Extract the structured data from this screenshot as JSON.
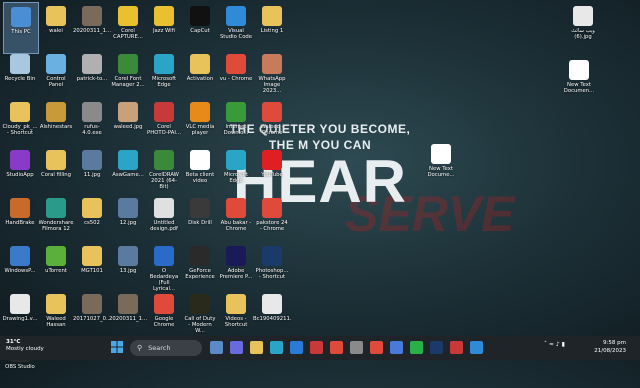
{
  "wallpaper": {
    "line1": "THE QUIETER YOU BECOME,",
    "line2": "THE M   YOU CAN",
    "line3": "HEAR",
    "overlay": "SERVE"
  },
  "desktop_icons": [
    {
      "label": "This PC",
      "icon": "this-pc-icon",
      "color": "#4a8fd6",
      "selected": true
    },
    {
      "label": "walei",
      "icon": "folder-icon",
      "color": "#e8c25a"
    },
    {
      "label": "20200311_1...",
      "icon": "image-file-icon",
      "color": "#7a6a5a"
    },
    {
      "label": "Corel CAPTURE...",
      "icon": "corel-capture-icon",
      "color": "#e8c030"
    },
    {
      "label": "Jazz Wifi",
      "icon": "jazz-wifi-icon",
      "color": "#e8c030"
    },
    {
      "label": "CapCut",
      "icon": "capcut-icon",
      "color": "#111111"
    },
    {
      "label": "Visual Studio Code",
      "icon": "vscode-icon",
      "color": "#2f8ad8"
    },
    {
      "label": "Listing 1",
      "icon": "folder-icon",
      "color": "#e8c25a"
    },
    {
      "label": "Recycle Bin",
      "icon": "recycle-bin-icon",
      "color": "#a8c8e0"
    },
    {
      "label": "Control Panel",
      "icon": "control-panel-icon",
      "color": "#6ab0e0"
    },
    {
      "label": "patrick-to...",
      "icon": "image-file-icon",
      "color": "#b0b0b0"
    },
    {
      "label": "Corel Font Manager 2...",
      "icon": "corel-font-icon",
      "color": "#3a8a3a"
    },
    {
      "label": "Microsoft Edge",
      "icon": "edge-icon",
      "color": "#2aa5c8"
    },
    {
      "label": "Activation",
      "icon": "folder-icon",
      "color": "#e8c25a"
    },
    {
      "label": "vu - Chrome",
      "icon": "chrome-icon",
      "color": "#e04a3a"
    },
    {
      "label": "WhatsApp Image 2023...",
      "icon": "image-file-icon",
      "color": "#c87a5a"
    },
    {
      "label": "Cloudy_pk_... - Shortcut",
      "icon": "folder-icon",
      "color": "#e8c25a"
    },
    {
      "label": "Alshinestars",
      "icon": "video-icon",
      "color": "#c89a3a"
    },
    {
      "label": "rufus-4.0.exe",
      "icon": "usb-icon",
      "color": "#8a8a8a"
    },
    {
      "label": "waleed.jpg",
      "icon": "image-file-icon",
      "color": "#c8a07a"
    },
    {
      "label": "Corel PHOTO-PAI...",
      "icon": "corel-photo-icon",
      "color": "#c83a3a"
    },
    {
      "label": "VLC media player",
      "icon": "vlc-icon",
      "color": "#e88a1a"
    },
    {
      "label": "Internet Downlo...",
      "icon": "idm-icon",
      "color": "#3a9a3a"
    },
    {
      "label": "Waleed - Chrome",
      "icon": "chrome-icon",
      "color": "#e04a3a"
    },
    {
      "label": "StudioApp",
      "icon": "studio-icon",
      "color": "#8a3ac8"
    },
    {
      "label": "Coral filling",
      "icon": "folder-icon",
      "color": "#e8c25a"
    },
    {
      "label": "11.jpg",
      "icon": "image-file-icon",
      "color": "#5a7aa0"
    },
    {
      "label": "AswGame...",
      "icon": "edge-icon",
      "color": "#2aa5c8"
    },
    {
      "label": "CorelDRAW 2021 (64-Bit)",
      "icon": "coreldraw-icon",
      "color": "#3a8a3a"
    },
    {
      "label": "Beta client video",
      "icon": "video-file-icon",
      "color": "#ffffff"
    },
    {
      "label": "Microsoft Edge",
      "icon": "edge-icon",
      "color": "#2aa5c8"
    },
    {
      "label": "YouTube",
      "icon": "youtube-icon",
      "color": "#e02020"
    },
    {
      "label": "HandBrake",
      "icon": "handbrake-icon",
      "color": "#c86a2a"
    },
    {
      "label": "Wondershare Filmora 12",
      "icon": "filmora-icon",
      "color": "#2a9a8a"
    },
    {
      "label": "cs502",
      "icon": "folder-icon",
      "color": "#e8c25a"
    },
    {
      "label": "12.jpg",
      "icon": "image-file-icon",
      "color": "#5a7aa0"
    },
    {
      "label": "Untitled design.pdf",
      "icon": "pdf-icon",
      "color": "#e0e0e0"
    },
    {
      "label": "Disk Drill",
      "icon": "disk-drill-icon",
      "color": "#3a3a3a"
    },
    {
      "label": "Abu bakar - Chrome",
      "icon": "chrome-icon",
      "color": "#e04a3a"
    },
    {
      "label": "pakstore 24 - Chrome",
      "icon": "chrome-icon",
      "color": "#e04a3a"
    },
    {
      "label": "WindowsP...",
      "icon": "windows-icon",
      "color": "#3a7ac8"
    },
    {
      "label": "uTorrent",
      "icon": "utorrent-icon",
      "color": "#5ab03a"
    },
    {
      "label": "MGT101",
      "icon": "folder-icon",
      "color": "#e8c25a"
    },
    {
      "label": "13.jpg",
      "icon": "image-file-icon",
      "color": "#5a7aa0"
    },
    {
      "label": "O Bedardeya (Full Lyrical...",
      "icon": "media-file-icon",
      "color": "#2a6ac8"
    },
    {
      "label": "GeForce Experience",
      "icon": "geforce-icon",
      "color": "#2a2a2a"
    },
    {
      "label": "Adobe Premiere P...",
      "icon": "premiere-icon",
      "color": "#1a1a5a"
    },
    {
      "label": "Photoshop... - Shortcut",
      "icon": "photoshop-icon",
      "color": "#1a3a6a"
    },
    {
      "label": "Drawing1.v...",
      "icon": "document-icon",
      "color": "#e8e8e8"
    },
    {
      "label": "Waleed Hassan",
      "icon": "folder-icon",
      "color": "#e8c25a"
    },
    {
      "label": "20171027_0...",
      "icon": "image-file-icon",
      "color": "#7a6a5a"
    },
    {
      "label": "20200311_1...",
      "icon": "image-file-icon",
      "color": "#7a6a5a"
    },
    {
      "label": "Google Chrome",
      "icon": "chrome-icon",
      "color": "#e04a3a"
    },
    {
      "label": "Call of Duty - Modern W...",
      "icon": "game-icon",
      "color": "#2a2a1a"
    },
    {
      "label": "Videos - Shortcut",
      "icon": "folder-icon",
      "color": "#e8c25a"
    },
    {
      "label": "Bc190409211...",
      "icon": "document-icon",
      "color": "#e8e8e8"
    },
    {
      "label": "OBS Studio",
      "icon": "obs-icon",
      "color": "#2a2a2a"
    },
    {
      "label": "ویب سائٹ (6).jpg",
      "icon": "image-file-icon",
      "color": "#e8e8e8"
    },
    {
      "label": "New Text Documen...",
      "icon": "text-file-icon",
      "color": "#ffffff"
    },
    {
      "label": "New Text Docume...",
      "icon": "text-file-icon",
      "color": "#ffffff"
    }
  ],
  "taskbar": {
    "weather_temp": "31°C",
    "weather_desc": "Mostly cloudy",
    "search_placeholder": "Search",
    "apps": [
      {
        "icon": "task-view-icon",
        "color": "#5a8ac8"
      },
      {
        "icon": "chat-icon",
        "color": "#6a6ae0"
      },
      {
        "icon": "file-explorer-icon",
        "color": "#e8c25a"
      },
      {
        "icon": "edge-icon",
        "color": "#2aa5c8"
      },
      {
        "icon": "mail-icon",
        "color": "#2a7ad8"
      },
      {
        "icon": "calendar-icon",
        "color": "#c83a3a"
      },
      {
        "icon": "chrome-icon",
        "color": "#e04a3a"
      },
      {
        "icon": "settings-icon",
        "color": "#8a8a8a"
      },
      {
        "icon": "chrome-icon",
        "color": "#e04a3a"
      },
      {
        "icon": "store-icon",
        "color": "#4a7ad8"
      },
      {
        "icon": "whatsapp-icon",
        "color": "#2ab04a"
      },
      {
        "icon": "photoshop-icon",
        "color": "#1a3a6a"
      },
      {
        "icon": "davinci-icon",
        "color": "#c83a3a"
      },
      {
        "icon": "vscode-icon",
        "color": "#2f8ad8"
      }
    ],
    "time": "9:58 pm",
    "date": "21/08/2023"
  }
}
